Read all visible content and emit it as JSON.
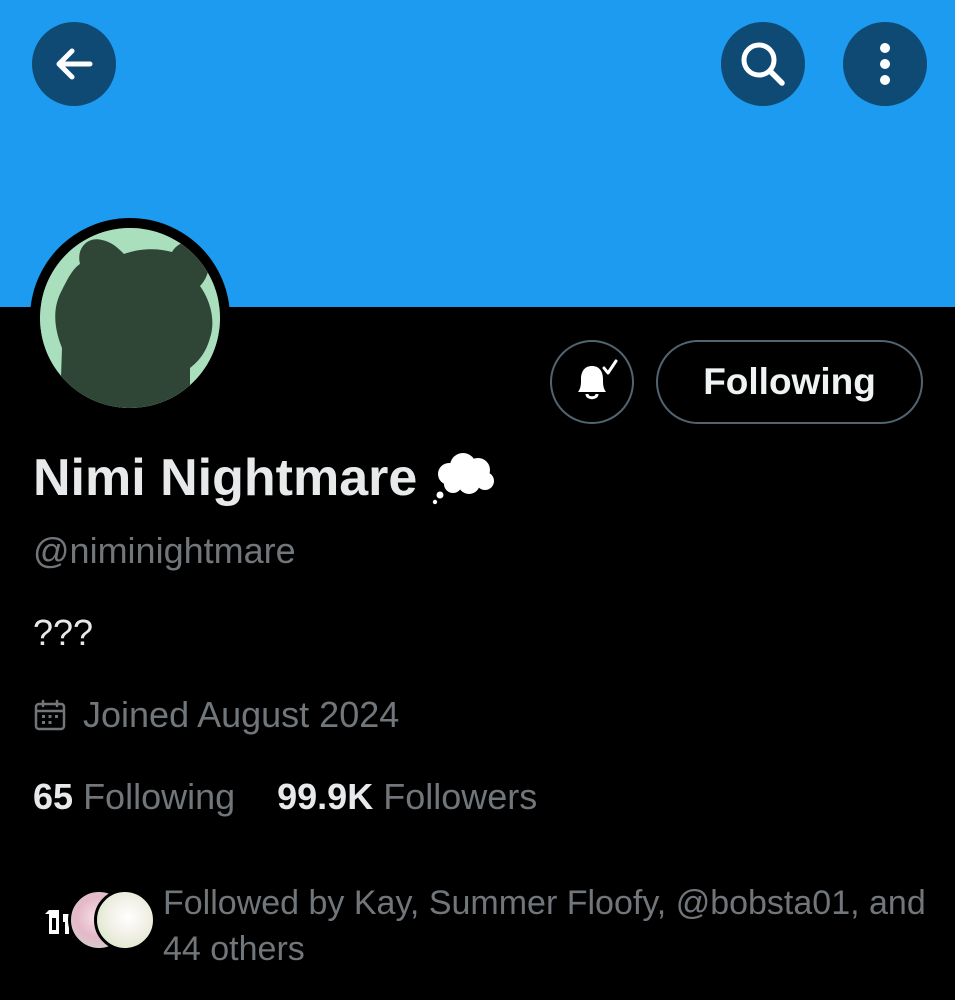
{
  "banner": {
    "color": "#1d9bf0"
  },
  "top_bar": {
    "back_icon": "arrow-left-icon",
    "search_icon": "search-icon",
    "more_icon": "more-vertical-icon"
  },
  "profile": {
    "display_name": "Nimi Nightmare",
    "name_badge_icon": "thought-bubble-icon",
    "handle": "@niminightmare",
    "bio": "???",
    "joined": "Joined August 2024",
    "following_count": "65",
    "following_label": "Following",
    "followers_count": "99.9K",
    "followers_label": "Followers"
  },
  "actions": {
    "notifications_icon": "bell-check-icon",
    "follow_button_label": "Following"
  },
  "followed_by": {
    "text": "Followed by Kay, Summer Floofy, @bobsta01, and 44 others"
  },
  "colors": {
    "background": "#000000",
    "primary_text": "#e7e9ea",
    "secondary_text": "#71767b",
    "border": "#536471"
  }
}
